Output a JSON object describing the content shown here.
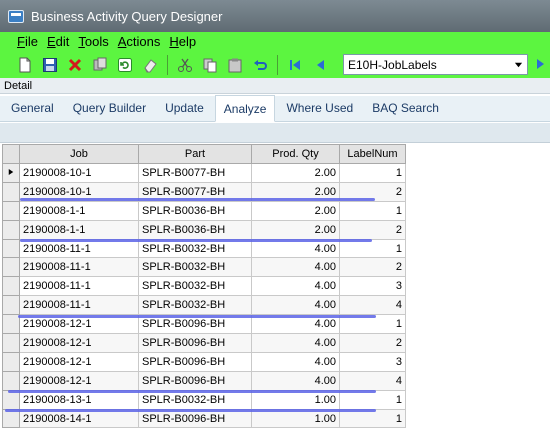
{
  "window": {
    "title": "Business Activity Query Designer",
    "icon": "app-window-icon"
  },
  "menu": [
    {
      "underline": "F",
      "rest": "ile"
    },
    {
      "underline": "E",
      "rest": "dit"
    },
    {
      "underline": "T",
      "rest": "ools"
    },
    {
      "underline": "A",
      "rest": "ctions"
    },
    {
      "underline": "H",
      "rest": "elp"
    }
  ],
  "toolbar": {
    "query_selector": "E10H-JobLabels",
    "icons": [
      "new-icon",
      "save-icon",
      "delete-icon",
      "copy-icon",
      "refresh-icon",
      "clear-icon",
      "cut-icon",
      "paste-icon",
      "clipboard-icon",
      "undo-icon",
      "first-record-icon",
      "previous-record-icon",
      "next-record-icon"
    ]
  },
  "detail_label": "Detail",
  "tabs": [
    {
      "label": "General",
      "active": false
    },
    {
      "label": "Query Builder",
      "active": false
    },
    {
      "label": "Update",
      "active": false
    },
    {
      "label": "Analyze",
      "active": true
    },
    {
      "label": "Where Used",
      "active": false
    },
    {
      "label": "BAQ Search",
      "active": false
    }
  ],
  "grid": {
    "columns": [
      "Job",
      "Part",
      "Prod. Qty",
      "LabelNum"
    ],
    "rows": [
      {
        "job": "2190008-10-1",
        "part": "SPLR-B0077-BH",
        "qty": "2.00",
        "label": "1",
        "current": true
      },
      {
        "job": "2190008-10-1",
        "part": "SPLR-B0077-BH",
        "qty": "2.00",
        "label": "2"
      },
      {
        "job": "2190008-1-1",
        "part": "SPLR-B0036-BH",
        "qty": "2.00",
        "label": "1"
      },
      {
        "job": "2190008-1-1",
        "part": "SPLR-B0036-BH",
        "qty": "2.00",
        "label": "2"
      },
      {
        "job": "2190008-11-1",
        "part": "SPLR-B0032-BH",
        "qty": "4.00",
        "label": "1"
      },
      {
        "job": "2190008-11-1",
        "part": "SPLR-B0032-BH",
        "qty": "4.00",
        "label": "2"
      },
      {
        "job": "2190008-11-1",
        "part": "SPLR-B0032-BH",
        "qty": "4.00",
        "label": "3"
      },
      {
        "job": "2190008-11-1",
        "part": "SPLR-B0032-BH",
        "qty": "4.00",
        "label": "4"
      },
      {
        "job": "2190008-12-1",
        "part": "SPLR-B0096-BH",
        "qty": "4.00",
        "label": "1"
      },
      {
        "job": "2190008-12-1",
        "part": "SPLR-B0096-BH",
        "qty": "4.00",
        "label": "2"
      },
      {
        "job": "2190008-12-1",
        "part": "SPLR-B0096-BH",
        "qty": "4.00",
        "label": "3"
      },
      {
        "job": "2190008-12-1",
        "part": "SPLR-B0096-BH",
        "qty": "4.00",
        "label": "4"
      },
      {
        "job": "2190008-13-1",
        "part": "SPLR-B0032-BH",
        "qty": "1.00",
        "label": "1"
      },
      {
        "job": "2190008-14-1",
        "part": "SPLR-B0096-BH",
        "qty": "1.00",
        "label": "1"
      }
    ]
  },
  "colors": {
    "menubar": "#5cf540",
    "titlebar": "#6b7780",
    "group_separator": "#5a63e6"
  }
}
